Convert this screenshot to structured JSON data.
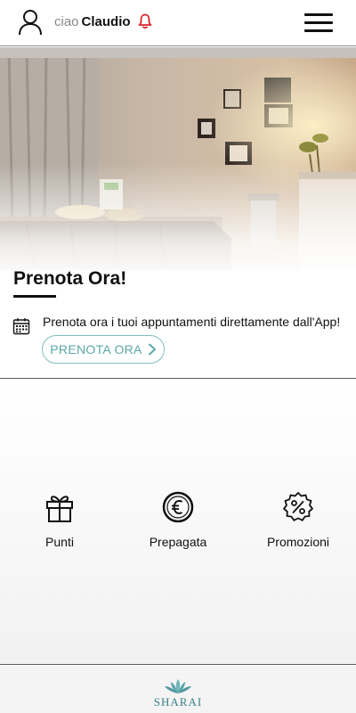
{
  "header": {
    "greeting": "ciao",
    "user_name": "Claudio",
    "user_icon": "user-icon",
    "notification_icon": "bell-icon",
    "menu_icon": "hamburger-menu-icon",
    "notification_color": "#d9262c"
  },
  "hero": {
    "title": "Prenota Ora!",
    "description": "Prenota ora i tuoi appuntamenti direttamente dall'App!",
    "calendar_icon": "calendar-icon",
    "button_label": "PRENOTA ORA",
    "button_icon": "chevron-right-icon",
    "accent_color": "#5aa8a8"
  },
  "features": [
    {
      "label": "Punti",
      "icon": "gift-icon"
    },
    {
      "label": "Prepagata",
      "icon": "euro-coin-icon"
    },
    {
      "label": "Promozioni",
      "icon": "discount-badge-icon"
    }
  ],
  "footer": {
    "logo_text": "SHARAI",
    "logo_icon": "lotus-icon",
    "brand_color": "#3b7f86"
  }
}
